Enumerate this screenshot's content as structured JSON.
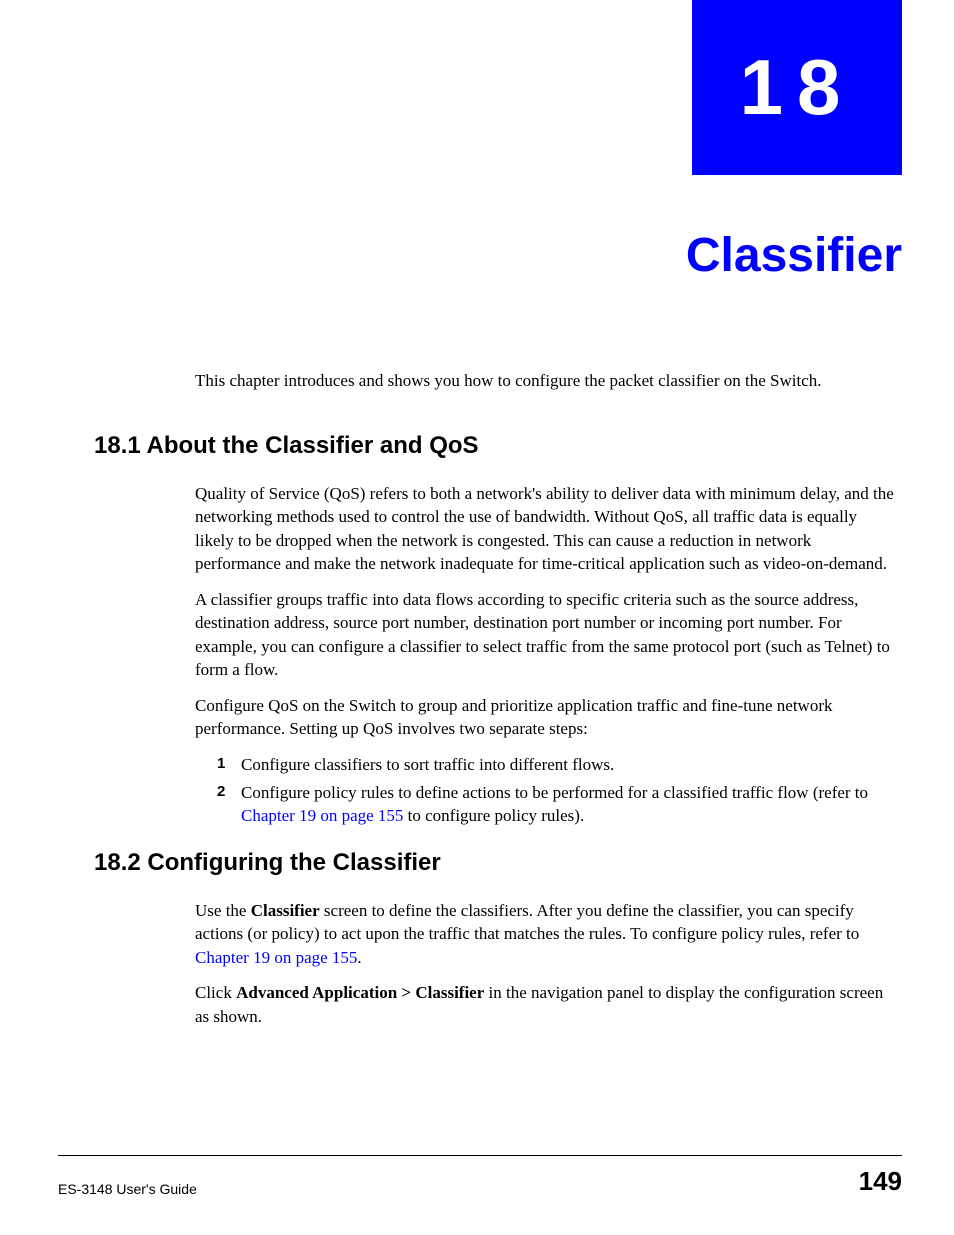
{
  "chapter": {
    "number": "18",
    "title": "Classifier"
  },
  "intro": "This chapter introduces and shows you how to configure the packet classifier on the Switch.",
  "section1": {
    "heading": "18.1  About the Classifier and QoS",
    "para1": "Quality of Service (QoS) refers to both a network's ability to deliver data with minimum delay, and the networking methods used to control the use of bandwidth. Without QoS, all traffic data is equally likely to be dropped when the network is congested. This can cause a reduction in network performance and make the network inadequate for time-critical application such as video-on-demand.",
    "para2": "A classifier groups traffic into data flows according to specific criteria such as the source address, destination address, source port number, destination port number or incoming port number. For example, you can configure a classifier to select traffic from the same protocol port (such as Telnet) to form a flow.",
    "para3": "Configure QoS on the Switch to group and prioritize application traffic and fine-tune network performance. Setting up QoS involves two separate steps:",
    "list": {
      "item1_num": "1",
      "item1_text": "Configure classifiers to sort traffic into different flows.",
      "item2_num": "2",
      "item2_text_a": "Configure policy rules to define actions to be performed for a classified traffic flow (refer to ",
      "item2_link": "Chapter 19 on page 155",
      "item2_text_b": " to configure policy rules)."
    }
  },
  "section2": {
    "heading": "18.2  Configuring the Classifier",
    "para1_a": "Use the ",
    "para1_bold1": "Classifier",
    "para1_b": " screen to define the classifiers. After you define the classifier, you can specify actions (or policy) to act upon the traffic that matches the rules. To configure policy rules, refer to ",
    "para1_link": "Chapter 19 on page 155",
    "para1_c": ".",
    "para2_a": "Click ",
    "para2_bold": "Advanced Application > Classifier",
    "para2_b": " in the navigation panel to display the configuration screen as shown."
  },
  "footer": {
    "guide": "ES-3148 User's Guide",
    "page": "149"
  }
}
